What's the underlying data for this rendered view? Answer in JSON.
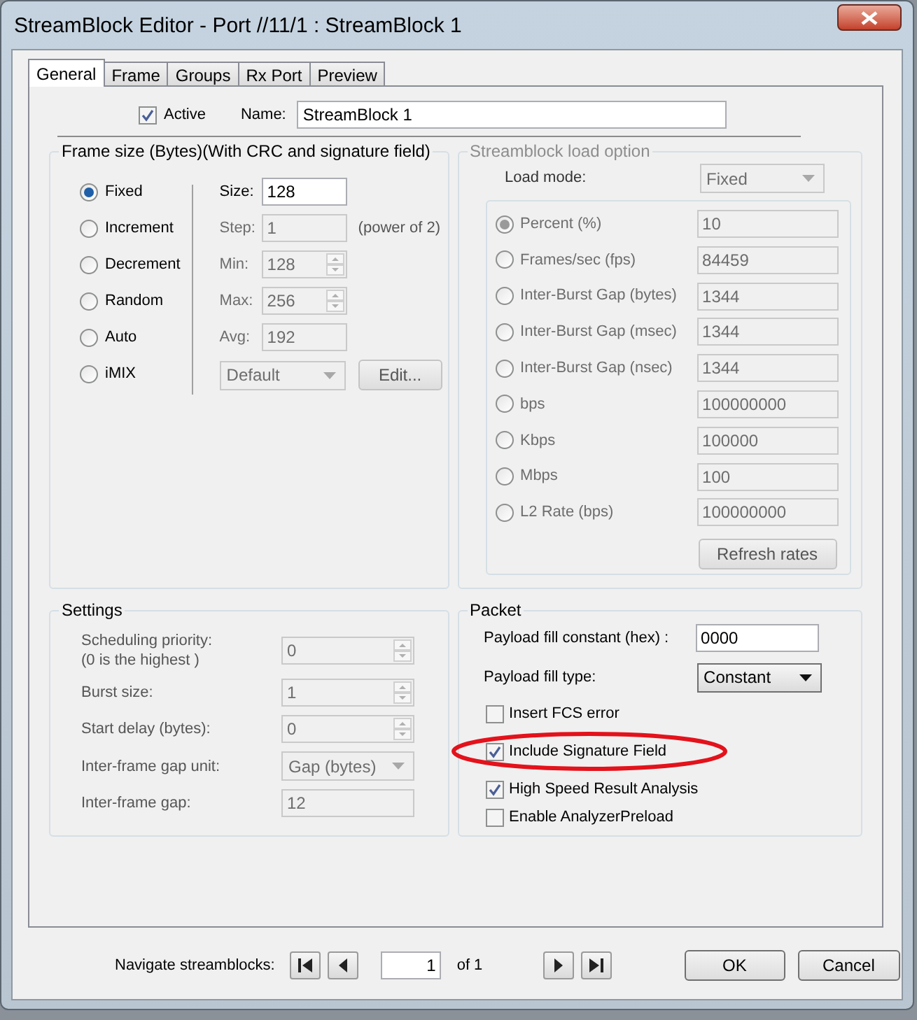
{
  "window": {
    "title": "StreamBlock Editor - Port //11/1 : StreamBlock 1"
  },
  "tabs": [
    {
      "label": "General",
      "selected": true
    },
    {
      "label": "Frame",
      "selected": false
    },
    {
      "label": "Groups",
      "selected": false
    },
    {
      "label": "Rx Port",
      "selected": false
    },
    {
      "label": "Preview",
      "selected": false
    }
  ],
  "active": {
    "label": "Active",
    "checked": true
  },
  "name": {
    "label": "Name:",
    "value": "StreamBlock 1"
  },
  "frame_size": {
    "title": "Frame size (Bytes)(With CRC and signature field)",
    "modes": [
      {
        "label": "Fixed",
        "selected": true
      },
      {
        "label": "Increment",
        "selected": false
      },
      {
        "label": "Decrement",
        "selected": false
      },
      {
        "label": "Random",
        "selected": false
      },
      {
        "label": "Auto",
        "selected": false
      },
      {
        "label": "iMIX",
        "selected": false
      }
    ],
    "fields": [
      {
        "label": "Size:",
        "value": "128",
        "kind": "text",
        "disabled": false
      },
      {
        "label": "Step:",
        "value": "1",
        "kind": "text",
        "disabled": true,
        "note": "(power of 2)"
      },
      {
        "label": "Min:",
        "value": "128",
        "kind": "spin",
        "disabled": true
      },
      {
        "label": "Max:",
        "value": "256",
        "kind": "spin",
        "disabled": true
      },
      {
        "label": "Avg:",
        "value": "192",
        "kind": "text",
        "disabled": true
      }
    ],
    "imix": {
      "value": "Default",
      "disabled": true,
      "button": "Edit..."
    }
  },
  "load_option": {
    "title": "Streamblock load option",
    "disabled": true,
    "load_mode": {
      "label": "Load mode:",
      "value": "Fixed"
    },
    "rates": [
      {
        "label": "Percent (%)",
        "value": "10",
        "selected": true
      },
      {
        "label": "Frames/sec (fps)",
        "value": "84459",
        "selected": false
      },
      {
        "label": "Inter-Burst Gap (bytes)",
        "value": "1344",
        "selected": false
      },
      {
        "label": "Inter-Burst Gap (msec)",
        "value": "1344",
        "selected": false
      },
      {
        "label": "Inter-Burst Gap (nsec)",
        "value": "1344",
        "selected": false
      },
      {
        "label": "bps",
        "value": "100000000",
        "selected": false
      },
      {
        "label": "Kbps",
        "value": "100000",
        "selected": false
      },
      {
        "label": "Mbps",
        "value": "100",
        "selected": false
      },
      {
        "label": "L2 Rate (bps)",
        "value": "100000000",
        "selected": false
      }
    ],
    "refresh": "Refresh rates"
  },
  "settings": {
    "title": "Settings",
    "rows": [
      {
        "label": "Scheduling priority:",
        "sublabel": "(0 is the highest )",
        "value": "0",
        "kind": "spin",
        "disabled": true
      },
      {
        "label": "Burst size:",
        "value": "1",
        "kind": "spin",
        "disabled": true
      },
      {
        "label": "Start delay (bytes):",
        "value": "0",
        "kind": "spin",
        "disabled": true
      },
      {
        "label": "Inter-frame gap unit:",
        "value": "Gap (bytes)",
        "kind": "select",
        "disabled": true
      },
      {
        "label": "Inter-frame gap:",
        "value": "12",
        "kind": "text",
        "disabled": true
      }
    ]
  },
  "packet": {
    "title": "Packet",
    "fill_constant": {
      "label": "Payload fill constant (hex) :",
      "value": "0000"
    },
    "fill_type": {
      "label": "Payload fill type:",
      "value": "Constant"
    },
    "options": [
      {
        "label": "Insert FCS error",
        "checked": false
      },
      {
        "label": "Include Signature Field",
        "checked": true
      },
      {
        "label": "High Speed Result Analysis",
        "checked": true
      },
      {
        "label": "Enable AnalyzerPreload",
        "checked": false
      }
    ]
  },
  "navigation": {
    "label": "Navigate streamblocks:",
    "value": "1",
    "total": "of 1"
  },
  "buttons": [
    "OK",
    "Cancel"
  ]
}
